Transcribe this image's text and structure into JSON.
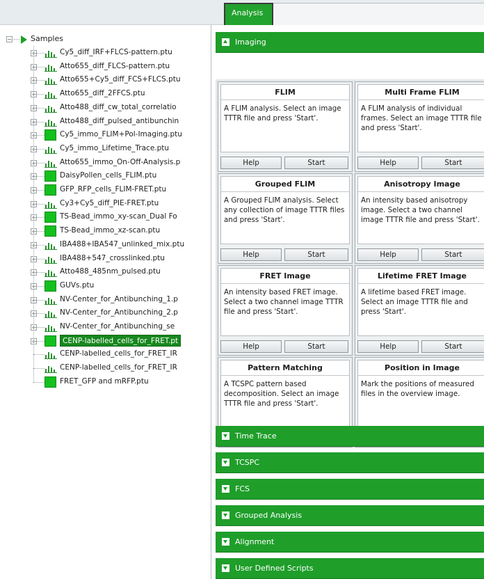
{
  "tabs": {
    "active": "Analysis"
  },
  "tree": {
    "root_label": "Samples",
    "items": [
      {
        "label": "Cy5_diff_IRF+FLCS-pattern.ptu",
        "icon": "chart-icon",
        "expandable": true
      },
      {
        "label": "Atto655_diff_FLCS-pattern.ptu",
        "icon": "chart-icon",
        "expandable": true
      },
      {
        "label": "Atto655+Cy5_diff_FCS+FLCS.ptu",
        "icon": "chart-icon",
        "expandable": true
      },
      {
        "label": "Atto655_diff_2FFCS.ptu",
        "icon": "chart-icon",
        "expandable": true
      },
      {
        "label": "Atto488_diff_cw_total_correlatio",
        "icon": "chart-icon",
        "expandable": true
      },
      {
        "label": "Atto488_diff_pulsed_antibunchin",
        "icon": "chart-icon",
        "expandable": true
      },
      {
        "label": "Cy5_immo_FLIM+Pol-Imaging.ptu",
        "icon": "image-icon",
        "expandable": true
      },
      {
        "label": "Cy5_immo_Lifetime_Trace.ptu",
        "icon": "chart-icon",
        "expandable": true
      },
      {
        "label": "Atto655_immo_On-Off-Analysis.p",
        "icon": "chart-icon",
        "expandable": true
      },
      {
        "label": "DaisyPollen_cells_FLIM.ptu",
        "icon": "image-icon",
        "expandable": true
      },
      {
        "label": "GFP_RFP_cells_FLIM-FRET.ptu",
        "icon": "image-icon",
        "expandable": true
      },
      {
        "label": "Cy3+Cy5_diff_PIE-FRET.ptu",
        "icon": "chart-icon",
        "expandable": true
      },
      {
        "label": "TS-Bead_immo_xy-scan_Dual Fo",
        "icon": "image-icon",
        "expandable": true
      },
      {
        "label": "TS-Bead_immo_xz-scan.ptu",
        "icon": "image-icon",
        "expandable": true
      },
      {
        "label": "IBA488+IBA547_unlinked_mix.ptu",
        "icon": "chart-icon",
        "expandable": true
      },
      {
        "label": "IBA488+547_crosslinked.ptu",
        "icon": "chart-icon",
        "expandable": true
      },
      {
        "label": "Atto488_485nm_pulsed.ptu",
        "icon": "chart-icon",
        "expandable": true
      },
      {
        "label": "GUVs.ptu",
        "icon": "image-icon",
        "expandable": true
      },
      {
        "label": "NV-Center_for_Antibunching_1.p",
        "icon": "chart-icon",
        "expandable": true
      },
      {
        "label": "NV-Center_for_Antibunching_2.p",
        "icon": "chart-icon",
        "expandable": true
      },
      {
        "label": "NV-Center_for_Antibunching_se",
        "icon": "chart-icon",
        "expandable": true
      },
      {
        "label": "CENP-labelled_cells_for_FRET.pt",
        "icon": "image-icon",
        "expandable": true,
        "selected": true
      },
      {
        "label": "CENP-labelled_cells_for_FRET_IR",
        "icon": "chart-icon",
        "expandable": false
      },
      {
        "label": "CENP-labelled_cells_for_FRET_IR",
        "icon": "chart-icon",
        "expandable": false
      },
      {
        "label": "FRET_GFP and mRFP.ptu",
        "icon": "image-icon",
        "expandable": false
      }
    ]
  },
  "sections": {
    "imaging": "Imaging",
    "collapsed": [
      "Time Trace",
      "TCSPC",
      "FCS",
      "Grouped Analysis",
      "Alignment",
      "User Defined Scripts"
    ]
  },
  "cards": [
    {
      "title": "FLIM",
      "desc": "A FLIM analysis. Select an image TTTR file and press 'Start'."
    },
    {
      "title": "Multi Frame FLIM",
      "desc": "A FLIM analysis of individual frames. Select an image TTTR file and press 'Start'."
    },
    {
      "title": "Grouped FLIM",
      "desc": "A Grouped FLIM analysis. Select any collection of image TTTR files and press 'Start'."
    },
    {
      "title": "Anisotropy Image",
      "desc": "An intensity based anisotropy image. Select a two channel image TTTR file and press 'Start'."
    },
    {
      "title": "FRET Image",
      "desc": "An intensity based FRET image. Select a two channel image TTTR file and press 'Start'."
    },
    {
      "title": "Lifetime FRET Image",
      "desc": "A lifetime based FRET image. Select an image TTTR file and press 'Start'."
    },
    {
      "title": "Pattern Matching",
      "desc": "A TCSPC pattern based decomposition. Select an image TTTR file and press 'Start'."
    },
    {
      "title": "Position in Image",
      "desc": "Mark the positions of measured files in the overview image."
    }
  ],
  "buttons": {
    "help": "Help",
    "start": "Start"
  },
  "colors": {
    "accent_green": "#1f9e2a",
    "selected_green": "#16871d",
    "icon_green": "#13c01e"
  }
}
